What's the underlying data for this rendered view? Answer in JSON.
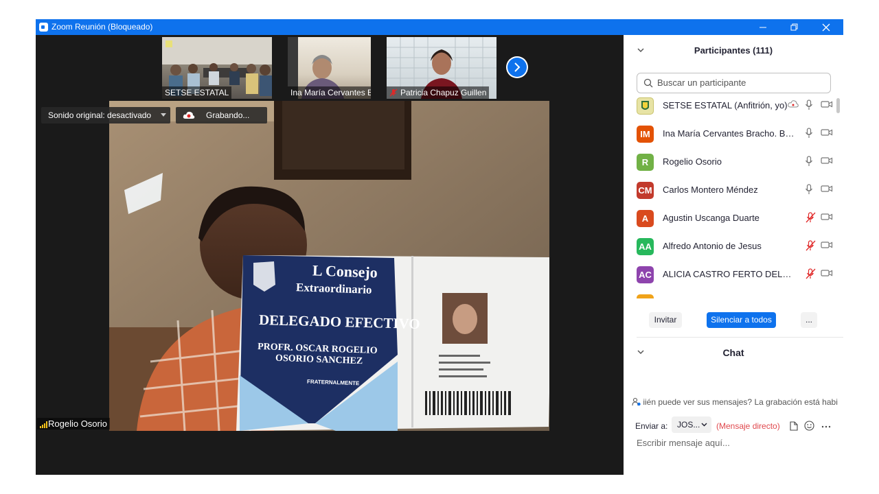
{
  "window": {
    "title": "Zoom Reunión (Bloqueado)",
    "accent": "#0e72ed"
  },
  "gallery": {
    "thumbnails": [
      {
        "name": "SETSE ESTATAL"
      },
      {
        "name": "Ina María Cervantes Bra..."
      },
      {
        "name": "Patricia Chapuz Guillen",
        "muted": true
      }
    ]
  },
  "video": {
    "original_sound": "Sonido original: desactivado",
    "recording": "Grabando...",
    "speaker": "Rogelio Osorio",
    "card_title_1": "L Consejo",
    "card_title_2": "Extraordinario",
    "card_role": "DELEGADO EFECTIVO",
    "card_name_1": "PROFR. OSCAR ROGELIO",
    "card_name_2": "OSORIO SANCHEZ",
    "card_org": "FRATERNALMENTE"
  },
  "participants": {
    "title": "Participantes (111)",
    "search_placeholder": "Buscar un participante",
    "list": [
      {
        "name": "SETSE ESTATAL (Anfitrión, yo)",
        "initials": "",
        "color": "#d9d9a0",
        "mic": "on",
        "cloud": true
      },
      {
        "name": "Ina María Cervantes Bracho. Bo...",
        "initials": "IM",
        "color": "#e35205",
        "mic": "on"
      },
      {
        "name": "Rogelio Osorio",
        "initials": "R",
        "color": "#71b146",
        "mic": "on"
      },
      {
        "name": "Carlos Montero  Méndez",
        "initials": "CM",
        "color": "#c23a2c",
        "mic": "on"
      },
      {
        "name": "Agustin Uscanga Duarte",
        "initials": "A",
        "color": "#d94a1e",
        "mic": "muted"
      },
      {
        "name": "Alfredo Antonio de Jesus",
        "initials": "AA",
        "color": "#27b85c",
        "mic": "muted"
      },
      {
        "name": "ALICIA CASTRO FERTO DELEGAC...",
        "initials": "AC",
        "color": "#8e44ad",
        "mic": "muted"
      }
    ],
    "invite": "Invitar",
    "mute_all": "Silenciar a todos",
    "more": "..."
  },
  "chat": {
    "title": "Chat",
    "notice": "iién puede ver sus mensajes? La grabación está habilit",
    "send_to_label": "Enviar a:",
    "recipient": "JOS...",
    "direct": "(Mensaje directo)",
    "input_placeholder": "Escribir mensaje aquí..."
  }
}
